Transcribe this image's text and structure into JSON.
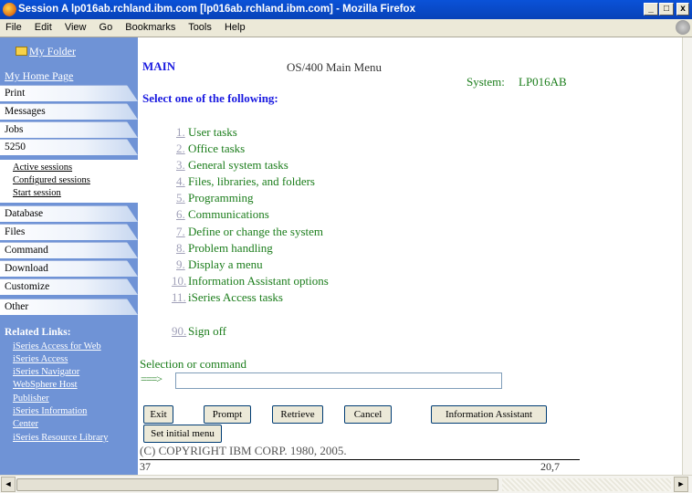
{
  "window": {
    "title": "Session A lp016ab.rchland.ibm.com [lp016ab.rchland.ibm.com] - Mozilla Firefox",
    "minimize_glyph": "_",
    "maximize_glyph": "□",
    "close_glyph": "x"
  },
  "menubar": {
    "items": [
      "File",
      "Edit",
      "View",
      "Go",
      "Bookmarks",
      "Tools",
      "Help"
    ]
  },
  "sidebar": {
    "folder_label": "My Folder",
    "home_label": "My Home Page",
    "nav": [
      {
        "label": "Print"
      },
      {
        "label": "Messages"
      },
      {
        "label": "Jobs"
      },
      {
        "label": "5250"
      },
      {
        "label": "Database"
      },
      {
        "label": "Files"
      },
      {
        "label": "Command"
      },
      {
        "label": "Download"
      },
      {
        "label": "Customize"
      },
      {
        "label": "Other"
      }
    ],
    "subnav": [
      {
        "label": "Active sessions"
      },
      {
        "label": "Configured sessions"
      },
      {
        "label": "Start session"
      }
    ],
    "related_title": "Related Links:",
    "related_lines": [
      "iSeries Access for Web",
      "iSeries Access",
      "iSeries Navigator",
      "WebSphere Host",
      "Publisher",
      "iSeries Information",
      "Center",
      "iSeries Resource Library"
    ]
  },
  "screen": {
    "menu_id": "MAIN",
    "menu_title": "OS/400 Main Menu",
    "system_label": "System:",
    "system_name": "LP016AB",
    "select_prompt": "Select one of the following:",
    "options": [
      {
        "num": "1.",
        "text": "User tasks"
      },
      {
        "num": "2.",
        "text": "Office tasks"
      },
      {
        "num": "3.",
        "text": "General system tasks"
      },
      {
        "num": "4.",
        "text": "Files, libraries, and folders"
      },
      {
        "num": "5.",
        "text": "Programming"
      },
      {
        "num": "6.",
        "text": "Communications"
      },
      {
        "num": "7.",
        "text": "Define or change the system"
      },
      {
        "num": "8.",
        "text": "Problem handling"
      },
      {
        "num": "9.",
        "text": "Display a menu"
      },
      {
        "num": "10.",
        "text": "Information Assistant options"
      },
      {
        "num": "11.",
        "text": "iSeries Access tasks"
      },
      {
        "num": "90.",
        "text": "Sign off"
      }
    ],
    "command_label": "Selection or command",
    "command_arrow": "===>",
    "command_value": "",
    "buttons": {
      "exit": "Exit",
      "prompt": "Prompt",
      "retrieve": "Retrieve",
      "cancel": "Cancel",
      "info_assistant": "Information Assistant",
      "set_initial_menu": "Set initial menu"
    },
    "copyright": "(C) COPYRIGHT IBM CORP. 1980, 2005.",
    "status_left": "37",
    "status_right": "20,7"
  },
  "scrollbar_glyphs": {
    "left": "◄",
    "right": "►"
  }
}
